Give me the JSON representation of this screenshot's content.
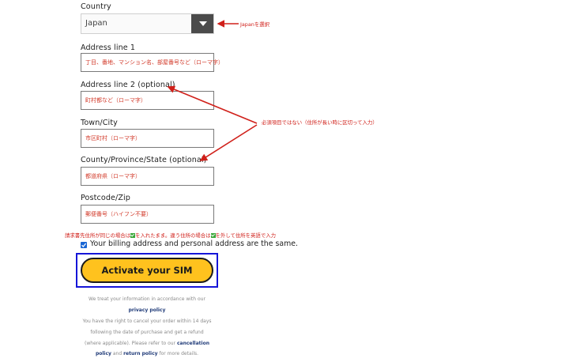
{
  "country": {
    "label": "Country",
    "value": "Japan",
    "annotation": "Japanを選択"
  },
  "address1": {
    "label": "Address line 1",
    "placeholder": "丁目、番地、マンション名、部屋番号など（ローマ字）"
  },
  "address2": {
    "label": "Address line 2 (optional)",
    "placeholder": "町村都など（ローマ字）"
  },
  "city": {
    "label": "Town/City",
    "placeholder": "市区町村（ローマ字）"
  },
  "county": {
    "label": "County/Province/State (optional)",
    "placeholder": "都道府県（ローマ字）"
  },
  "postcode": {
    "label": "Postcode/Zip",
    "placeholder": "郵便番号（ハイフン不要）"
  },
  "annotations": {
    "optional_note": "必須項目ではない（住所が長い時に区切って入力）",
    "billing_note_1": "請求書先住所が同じの場合は",
    "billing_note_2": "を入れたまま。違う住所の場合は",
    "billing_note_3": "を外して住所を英語で入力"
  },
  "billing": {
    "label": "Your billing address and personal address are the same.",
    "checked": true
  },
  "cta": {
    "label": "Activate your SIM"
  },
  "legal": {
    "line1": "We treat your information in accordance with our",
    "privacy_link": "privacy policy",
    "line3": "You have the right to cancel your order within 14 days",
    "line4": "following the date of purchase and get a refund",
    "line5_pre": "(where applicable). Please refer to our",
    "cancellation_link": "cancellation",
    "policy_link": "policy",
    "and": "and",
    "return_link": "return policy",
    "line6_post": "for more details."
  },
  "colors": {
    "annotation_red": "#d0201a",
    "cta_yellow": "#ffc21e",
    "highlight_blue": "#1515d8",
    "link_navy": "#1f3a78"
  }
}
